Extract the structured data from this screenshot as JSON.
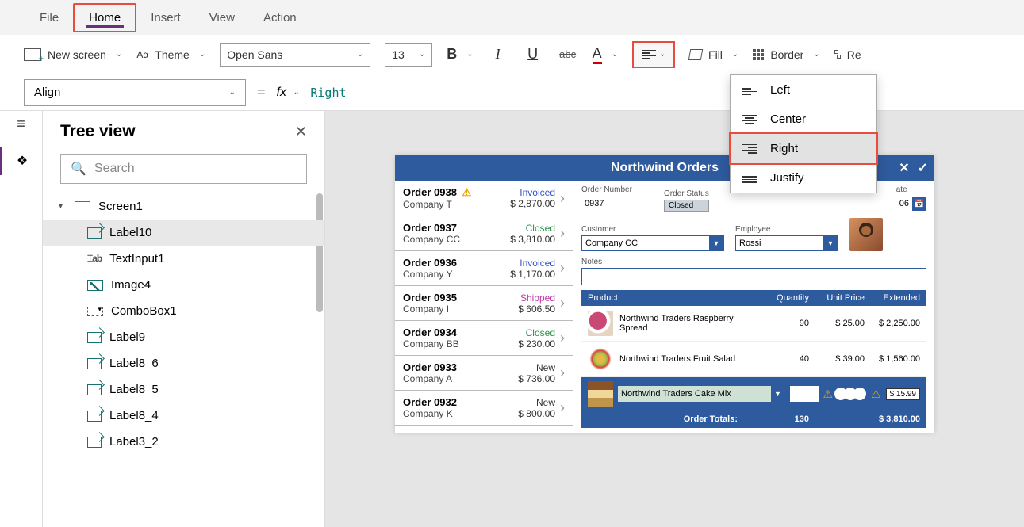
{
  "menubar": {
    "file": "File",
    "home": "Home",
    "insert": "Insert",
    "view": "View",
    "action": "Action"
  },
  "ribbon": {
    "new_screen": "New screen",
    "theme": "Theme",
    "font": "Open Sans",
    "size": "13",
    "fill": "Fill",
    "border": "Border",
    "reorder": "Re"
  },
  "formula": {
    "property": "Align",
    "value": "Right"
  },
  "tree": {
    "title": "Tree view",
    "search_ph": "Search",
    "root": "Screen1",
    "items": [
      "Label10",
      "TextInput1",
      "Image4",
      "ComboBox1",
      "Label9",
      "Label8_6",
      "Label8_5",
      "Label8_4",
      "Label3_2"
    ]
  },
  "align_menu": {
    "left": "Left",
    "center": "Center",
    "right": "Right",
    "justify": "Justify"
  },
  "app": {
    "title": "Northwind Orders",
    "orders": [
      {
        "num": "Order 0938",
        "warn": true,
        "company": "Company T",
        "status": "Invoiced",
        "scls": "st-invoiced",
        "amt": "$ 2,870.00"
      },
      {
        "num": "Order 0937",
        "company": "Company CC",
        "status": "Closed",
        "scls": "st-closed",
        "amt": "$ 3,810.00"
      },
      {
        "num": "Order 0936",
        "company": "Company Y",
        "status": "Invoiced",
        "scls": "st-invoiced",
        "amt": "$ 1,170.00"
      },
      {
        "num": "Order 0935",
        "company": "Company I",
        "status": "Shipped",
        "scls": "st-shipped",
        "amt": "$ 606.50"
      },
      {
        "num": "Order 0934",
        "company": "Company BB",
        "status": "Closed",
        "scls": "st-closed",
        "amt": "$ 230.00"
      },
      {
        "num": "Order 0933",
        "company": "Company A",
        "status": "New",
        "scls": "st-new",
        "amt": "$ 736.00"
      },
      {
        "num": "Order 0932",
        "company": "Company K",
        "status": "New",
        "scls": "st-new",
        "amt": "$ 800.00"
      }
    ],
    "detail": {
      "lbl_ordernum": "Order Number",
      "ordernum": "0937",
      "lbl_status": "Order Status",
      "status": "Closed",
      "lbl_date": "ate",
      "date": "06",
      "lbl_customer": "Customer",
      "customer": "Company CC",
      "lbl_employee": "Employee",
      "employee": "Rossi",
      "lbl_notes": "Notes",
      "hdr_product": "Product",
      "hdr_qty": "Quantity",
      "hdr_unit": "Unit Price",
      "hdr_ext": "Extended",
      "lines": [
        {
          "name": "Northwind Traders Raspberry Spread",
          "qty": "90",
          "unit": "$ 25.00",
          "ext": "$ 2,250.00",
          "img": "pimg1"
        },
        {
          "name": "Northwind Traders Fruit Salad",
          "qty": "40",
          "unit": "$ 39.00",
          "ext": "$ 1,560.00",
          "img": "pimg2"
        }
      ],
      "newprod": "Northwind Traders Cake Mix",
      "newprice": "$ 15.99",
      "totals_lbl": "Order Totals:",
      "totals_qty": "130",
      "totals_amt": "$ 3,810.00"
    }
  }
}
